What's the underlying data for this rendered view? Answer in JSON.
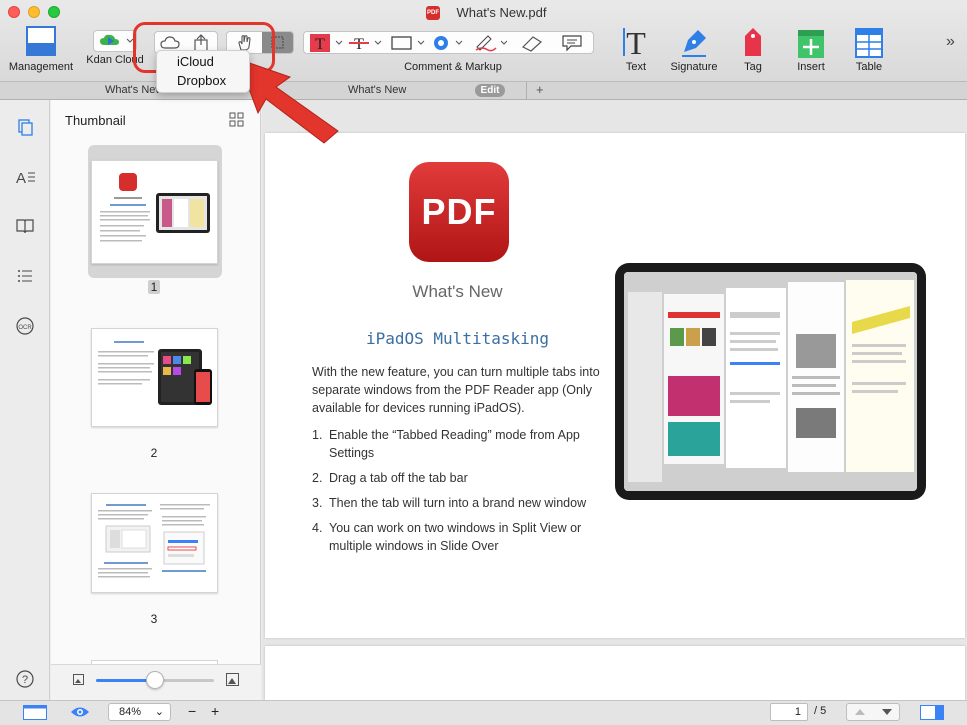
{
  "window": {
    "title": "What's New.pdf",
    "app_icon_text": "PDF"
  },
  "toolbar": {
    "management_label": "Management",
    "kdan_cloud_label": "Kdan Cloud",
    "comment_markup_label": "Comment & Markup",
    "text_label": "Text",
    "signature_label": "Signature",
    "tag_label": "Tag",
    "insert_label": "Insert",
    "table_label": "Table",
    "overflow_label": "»"
  },
  "share_menu": {
    "items": [
      "iCloud",
      "Dropbox"
    ]
  },
  "tabs": [
    {
      "label": "What's New"
    },
    {
      "label": "What's New"
    }
  ],
  "tab_edit_label": "Edit",
  "tab_add_label": "+",
  "thumbnail_panel": {
    "title": "Thumbnail",
    "pages": [
      "1",
      "2",
      "3"
    ],
    "zoom_fraction": 0.5
  },
  "document": {
    "logo_text": "PDF",
    "title": "What's New",
    "heading": "iPadOS Multitasking",
    "intro": "With the new feature, you can turn multiple tabs into separate windows from the PDF Reader app (Only available for devices running iPadOS).",
    "steps": [
      {
        "num": "1.",
        "text": "Enable the “Tabbed Reading” mode from App Settings"
      },
      {
        "num": "2.",
        "text": "Drag a tab off the tab bar"
      },
      {
        "num": "3.",
        "text": "Then the tab will turn into a brand new window"
      },
      {
        "num": "4.",
        "text": "You can work on two windows in Split View or multiple windows in Slide Over"
      }
    ]
  },
  "bottom_bar": {
    "zoom": "84%",
    "zoom_out": "−",
    "zoom_in": "+",
    "current_page": "1",
    "total_pages": "/ 5"
  },
  "colors": {
    "accent": "#3b82f6",
    "brand_red": "#d62d2d",
    "highlight_red": "#e2352b"
  }
}
